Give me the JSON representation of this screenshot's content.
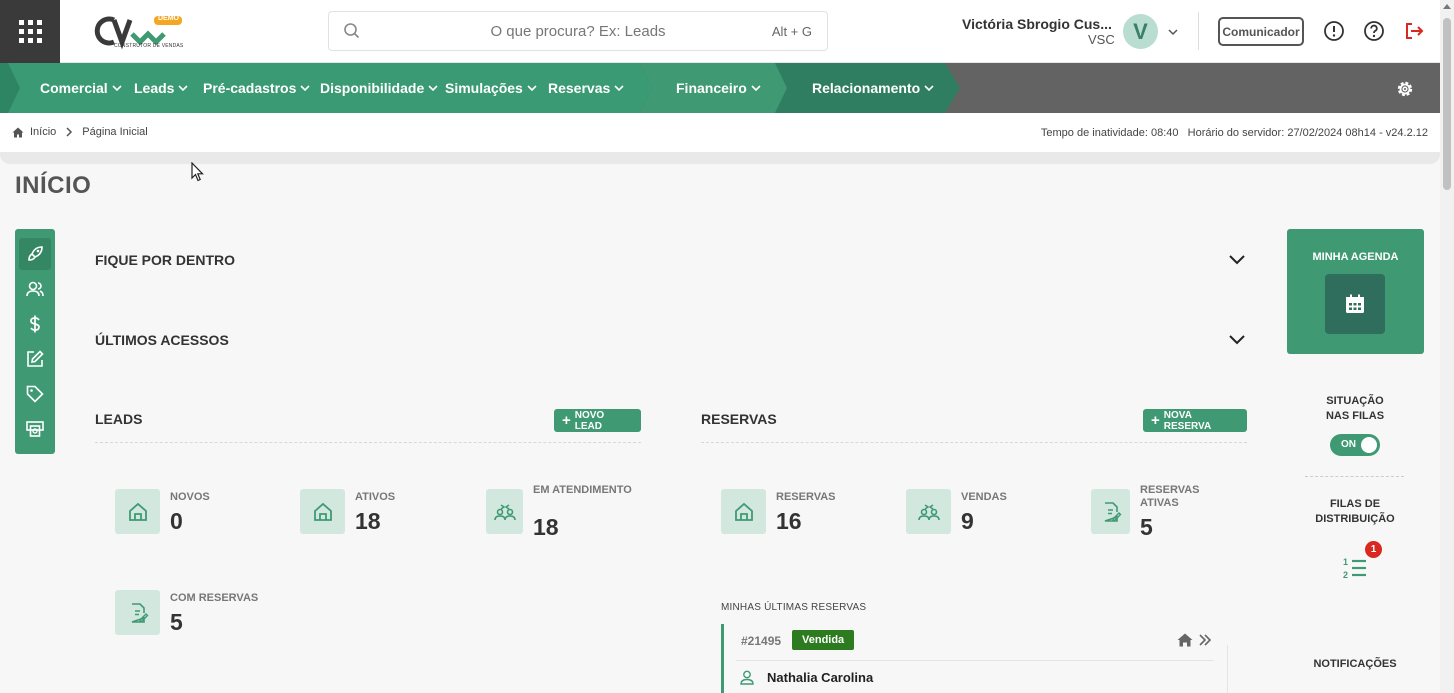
{
  "header": {
    "logo_text": "CV",
    "logo_badge": "DEMO",
    "logo_tagline": "CONSTRUTOR DE VENDAS",
    "search_placeholder": "O que procura? Ex: Leads",
    "search_shortcut": "Alt + G",
    "user_name": "Victória Sbrogio Cus...",
    "user_company": "VSC",
    "avatar_letter": "V",
    "communicator_label": "Comunicador"
  },
  "nav": {
    "items": [
      {
        "label": "Comercial"
      },
      {
        "label": "Leads"
      },
      {
        "label": "Pré-cadastros"
      },
      {
        "label": "Disponibilidade"
      },
      {
        "label": "Simulações"
      },
      {
        "label": "Reservas"
      },
      {
        "label": "Financeiro"
      },
      {
        "label": "Relacionamento"
      }
    ]
  },
  "breadcrumb": {
    "home": "Início",
    "current": "Página Inicial",
    "status": "Tempo de inatividade: 08:40   Horário do servidor: 27/02/2024 08h14 - v24.2.12"
  },
  "page": {
    "title": "INÍCIO"
  },
  "sections": {
    "fique_por_dentro": "FIQUE POR DENTRO",
    "ultimos_acessos": "ÚLTIMOS ACESSOS"
  },
  "leads": {
    "title": "LEADS",
    "new_button": "NOVO LEAD",
    "stats": [
      {
        "label": "NOVOS",
        "value": "0"
      },
      {
        "label": "ATIVOS",
        "value": "18"
      },
      {
        "label": "EM ATENDIMENTO",
        "value": "18"
      },
      {
        "label": "COM RESERVAS",
        "value": "5"
      }
    ]
  },
  "reservas": {
    "title": "RESERVAS",
    "new_button": "NOVA RESERVA",
    "stats": [
      {
        "label": "RESERVAS",
        "value": "16"
      },
      {
        "label": "VENDAS",
        "value": "9"
      },
      {
        "label": "RESERVAS ATIVAS",
        "value": "5"
      }
    ],
    "recent_title": "MINHAS ÚLTIMAS RESERVAS",
    "recent": [
      {
        "id": "#21495",
        "status": "Vendida",
        "client": "Nathalia Carolina"
      }
    ]
  },
  "right": {
    "agenda_title": "MINHA AGENDA",
    "queues_title": "SITUAÇÃO NAS FILAS",
    "queues_toggle": "ON",
    "distribution_title": "FILAS DE DISTRIBUIÇÃO",
    "distribution_badge": "1",
    "notifications_title": "NOTIFICAÇÕES"
  },
  "colors": {
    "brand_green": "#3f9a74",
    "dark_green": "#2f6e5c",
    "sold_badge": "#2c7b1f",
    "alert_red": "#d9281f"
  }
}
